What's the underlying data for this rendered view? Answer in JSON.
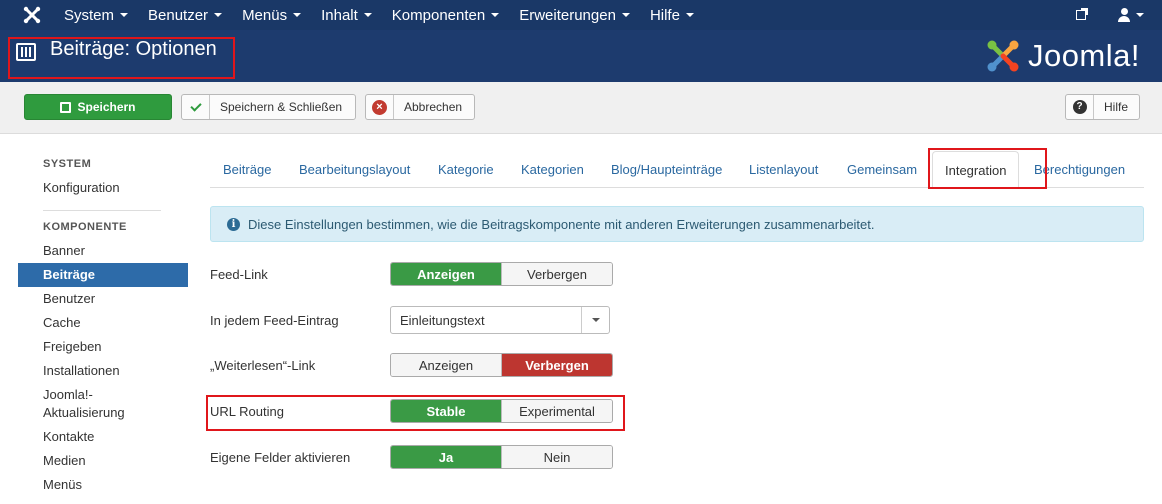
{
  "topnav": {
    "menu": [
      {
        "label": "System"
      },
      {
        "label": "Benutzer"
      },
      {
        "label": "Menüs"
      },
      {
        "label": "Inhalt"
      },
      {
        "label": "Komponenten"
      },
      {
        "label": "Erweiterungen"
      },
      {
        "label": "Hilfe"
      }
    ]
  },
  "header": {
    "title": "Beiträge: Optionen",
    "brand": "Joomla!"
  },
  "toolbar": {
    "save_label": "Speichern",
    "save_close_label": "Speichern & Schließen",
    "cancel_label": "Abbrechen",
    "help_label": "Hilfe"
  },
  "sidebar": {
    "system_heading": "SYSTEM",
    "system_items": [
      "Konfiguration"
    ],
    "component_heading": "KOMPONENTE",
    "component_items": [
      "Banner",
      "Beiträge",
      "Benutzer",
      "Cache",
      "Freigeben",
      "Installationen",
      "Joomla!-Aktualisierung",
      "Kontakte",
      "Medien",
      "Menüs"
    ],
    "active_item": "Beiträge"
  },
  "tabs": [
    "Beiträge",
    "Bearbeitungslayout",
    "Kategorie",
    "Kategorien",
    "Blog/Haupteinträge",
    "Listenlayout",
    "Gemeinsam",
    "Integration",
    "Berechtigungen"
  ],
  "active_tab": "Integration",
  "info_message": "Diese Einstellungen bestimmen, wie die Beitragskomponente mit anderen Erweiterungen zusammenarbeitet.",
  "form": {
    "feed_link": {
      "label": "Feed-Link",
      "options": [
        "Anzeigen",
        "Verbergen"
      ],
      "selected": "Anzeigen"
    },
    "feed_entry": {
      "label": "In jedem Feed-Eintrag",
      "value": "Einleitungstext"
    },
    "readmore": {
      "label": "„Weiterlesen“-Link",
      "options": [
        "Anzeigen",
        "Verbergen"
      ],
      "selected": "Verbergen"
    },
    "url_routing": {
      "label": "URL Routing",
      "options": [
        "Stable",
        "Experimental"
      ],
      "selected": "Stable"
    },
    "custom_fields": {
      "label": "Eigene Felder aktivieren",
      "options": [
        "Ja",
        "Nein"
      ],
      "selected": "Ja"
    }
  },
  "colors": {
    "nav_bg": "#1a3867",
    "header_bg": "#1d3b6e",
    "save_green": "#2f9b3e",
    "active_red": "#bd3630",
    "highlight_red": "#e0161b",
    "sidebar_active": "#2d6ba9",
    "info_bg": "#d9edf6"
  }
}
